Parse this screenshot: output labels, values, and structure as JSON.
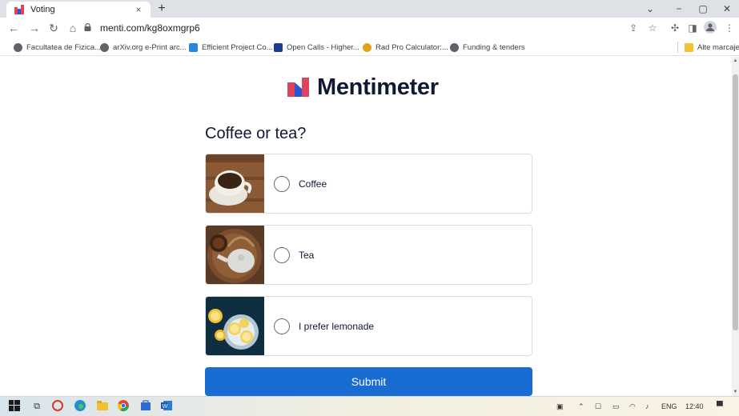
{
  "browser": {
    "tab_title": "Voting",
    "tab_close": "×",
    "new_tab": "+",
    "url": "menti.com/kg8oxmgrp6",
    "window_controls": [
      "⌄",
      "−",
      "▢",
      "✕"
    ]
  },
  "bookmarks": {
    "items": [
      {
        "label": "Facultatea de Fizica...",
        "color": "#5f6368"
      },
      {
        "label": "arXiv.org e-Print arc...",
        "color": "#5f6368"
      },
      {
        "label": "Efficient Project Co...",
        "color": "#2b88d8"
      },
      {
        "label": "Open Calls - Higher...",
        "color": "#1a3d8f"
      },
      {
        "label": "Rad Pro Calculator:...",
        "color": "#e3a21a"
      },
      {
        "label": "Funding & tenders",
        "color": "#5f6368"
      }
    ],
    "other": "Alte marcaje"
  },
  "page": {
    "brand": "Mentimeter",
    "question": "Coffee or tea?",
    "options": [
      {
        "label": "Coffee"
      },
      {
        "label": "Tea"
      },
      {
        "label": "I prefer lemonade"
      }
    ],
    "submit_label": "Submit",
    "accent": "#196cd2"
  },
  "taskbar": {
    "lang": "ENG",
    "time": "12:40"
  }
}
